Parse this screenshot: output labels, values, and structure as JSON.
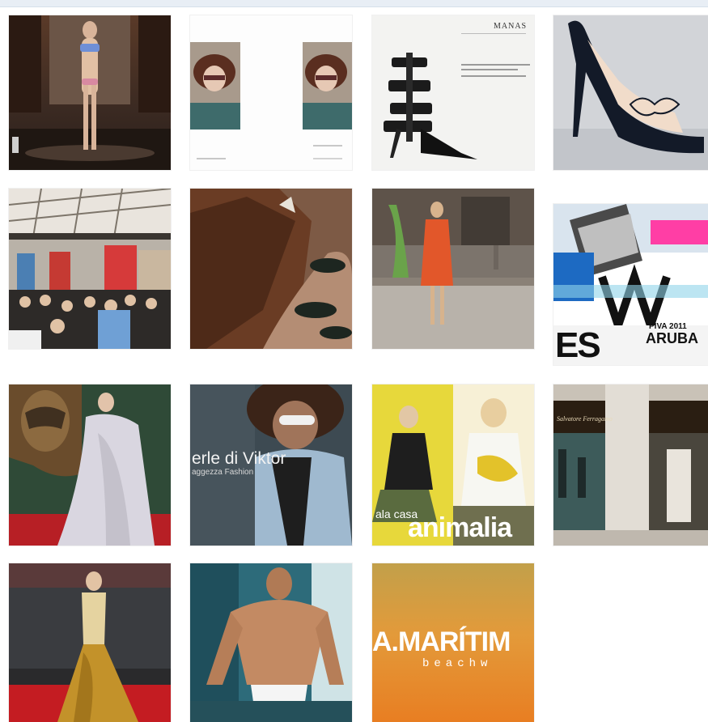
{
  "header": {
    "background_color": "#e8eef5"
  },
  "gallery": {
    "items": [
      {
        "subject": "runway model in blue bikini"
      },
      {
        "subject": "two portrait cards of woman with curly hair and glasses"
      },
      {
        "subject": "black strappy high-heel sandal ad",
        "heading_text": "MANAS"
      },
      {
        "subject": "black stiletto with butterfly bow"
      },
      {
        "subject": "fashion event crowd in hall"
      },
      {
        "subject": "hand with dark nail polish on brown suede"
      },
      {
        "subject": "woman in orange dress on street"
      },
      {
        "subject": "Aruba fashion week poster",
        "text_1": "PIVA 2011",
        "text_2": "ARUBA",
        "text_3": "ES"
      },
      {
        "subject": "woman in grey gown on red carpet"
      },
      {
        "subject": "man with white glasses and curly hair",
        "text_1": "erle di Viktor",
        "text_2": "aggezza Fashion"
      },
      {
        "subject": "two blonde women fashion spread",
        "text_1": "ala casa",
        "text_2": "animalia"
      },
      {
        "subject": "Salvatore Ferragamo store front",
        "text_1": "Salvatore Ferragamo"
      },
      {
        "subject": "woman in gold gown at Harry Potter premiere"
      },
      {
        "subject": "shirtless male swimwear model"
      },
      {
        "subject": "A.Marítima beachwear logo",
        "text_1": "A.MARÍTIM",
        "text_2": "beachw"
      }
    ]
  }
}
